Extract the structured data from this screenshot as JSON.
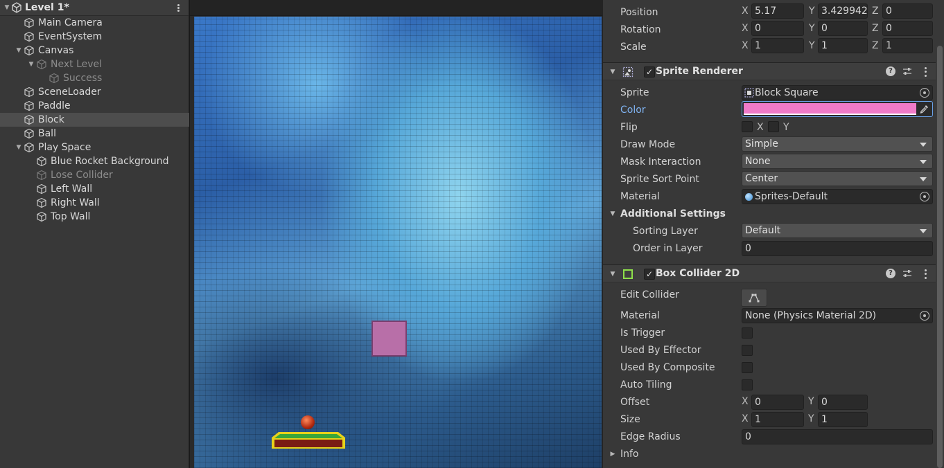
{
  "hierarchy": {
    "scene_name": "Level 1*",
    "items": [
      {
        "label": "Main Camera"
      },
      {
        "label": "EventSystem"
      },
      {
        "label": "Canvas"
      },
      {
        "label": "Next Level"
      },
      {
        "label": "Success"
      },
      {
        "label": "SceneLoader"
      },
      {
        "label": "Paddle"
      },
      {
        "label": "Block"
      },
      {
        "label": "Ball"
      },
      {
        "label": "Play Space"
      },
      {
        "label": "Blue Rocket Background"
      },
      {
        "label": "Lose Collider"
      },
      {
        "label": "Left Wall"
      },
      {
        "label": "Right Wall"
      },
      {
        "label": "Top Wall"
      }
    ]
  },
  "transform": {
    "position": {
      "label": "Position",
      "x": "5.17",
      "y": "3.429942",
      "z": "0"
    },
    "rotation": {
      "label": "Rotation",
      "x": "0",
      "y": "0",
      "z": "0"
    },
    "scale": {
      "label": "Scale",
      "x": "1",
      "y": "1",
      "z": "1"
    },
    "axis_x": "X",
    "axis_y": "Y",
    "axis_z": "Z"
  },
  "sprite_renderer": {
    "title": "Sprite Renderer",
    "sprite_label": "Sprite",
    "sprite_value": "Block Square",
    "color_label": "Color",
    "color_value": "#f07ac8",
    "flip_label": "Flip",
    "flip_x": "X",
    "flip_y": "Y",
    "draw_mode_label": "Draw Mode",
    "draw_mode_value": "Simple",
    "mask_label": "Mask Interaction",
    "mask_value": "None",
    "sort_point_label": "Sprite Sort Point",
    "sort_point_value": "Center",
    "material_label": "Material",
    "material_value": "Sprites-Default",
    "additional_label": "Additional Settings",
    "sorting_layer_label": "Sorting Layer",
    "sorting_layer_value": "Default",
    "order_label": "Order in Layer",
    "order_value": "0"
  },
  "box_collider": {
    "title": "Box Collider 2D",
    "edit_label": "Edit Collider",
    "material_label": "Material",
    "material_value": "None (Physics Material 2D)",
    "is_trigger_label": "Is Trigger",
    "effector_label": "Used By Effector",
    "composite_label": "Used By Composite",
    "auto_tiling_label": "Auto Tiling",
    "offset_label": "Offset",
    "offset_x": "0",
    "offset_y": "0",
    "size_label": "Size",
    "size_x": "1",
    "size_y": "1",
    "edge_radius_label": "Edge Radius",
    "edge_radius_value": "0",
    "info_label": "Info"
  },
  "colors": {
    "block": "#b86fa8",
    "accent_blue": "#7fb2f0"
  }
}
